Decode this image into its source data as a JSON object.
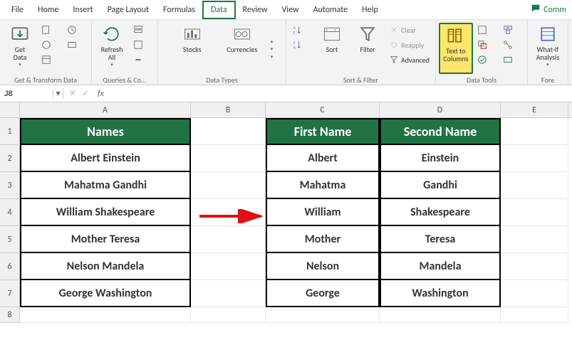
{
  "menu": {
    "items": [
      "File",
      "Home",
      "Insert",
      "Page Layout",
      "Formulas",
      "Data",
      "Review",
      "View",
      "Automate",
      "Help"
    ],
    "active": "Data",
    "comments": "Comm"
  },
  "ribbon": {
    "group1": {
      "label": "Get & Transform Data",
      "getdata": "Get\nData"
    },
    "group2": {
      "label": "Queries & Co...",
      "refresh": "Refresh\nAll"
    },
    "group3": {
      "label": "Data Types",
      "stocks": "Stocks",
      "currencies": "Currencies"
    },
    "group4": {
      "label": "Sort & Filter",
      "sort": "Sort",
      "filter": "Filter",
      "clear": "Clear",
      "reapply": "Reapply",
      "advanced": "Advanced"
    },
    "group5": {
      "label": "Data Tools",
      "textcols": "Text to\nColumns"
    },
    "group6": {
      "label": "Fore",
      "whatif": "What-If\nAnalysis"
    }
  },
  "nameBox": "J8",
  "colHeaders": [
    "A",
    "B",
    "C",
    "D",
    "E"
  ],
  "rowHeaders": [
    "1",
    "2",
    "3",
    "4",
    "5",
    "6",
    "7",
    "8"
  ],
  "table1": {
    "header": "Names",
    "rows": [
      "Albert Einstein",
      "Mahatma Gandhi",
      "William Shakespeare",
      "Mother Teresa",
      "Nelson Mandela",
      "George Washington"
    ]
  },
  "table2": {
    "headerFirst": "First Name",
    "headerSecond": "Second Name",
    "rows": [
      {
        "first": "Albert",
        "second": "Einstein"
      },
      {
        "first": "Mahatma",
        "second": "Gandhi"
      },
      {
        "first": "William",
        "second": "Shakespeare"
      },
      {
        "first": "Mother",
        "second": "Teresa"
      },
      {
        "first": "Nelson",
        "second": "Mandela"
      },
      {
        "first": "George",
        "second": "Washington"
      }
    ]
  }
}
